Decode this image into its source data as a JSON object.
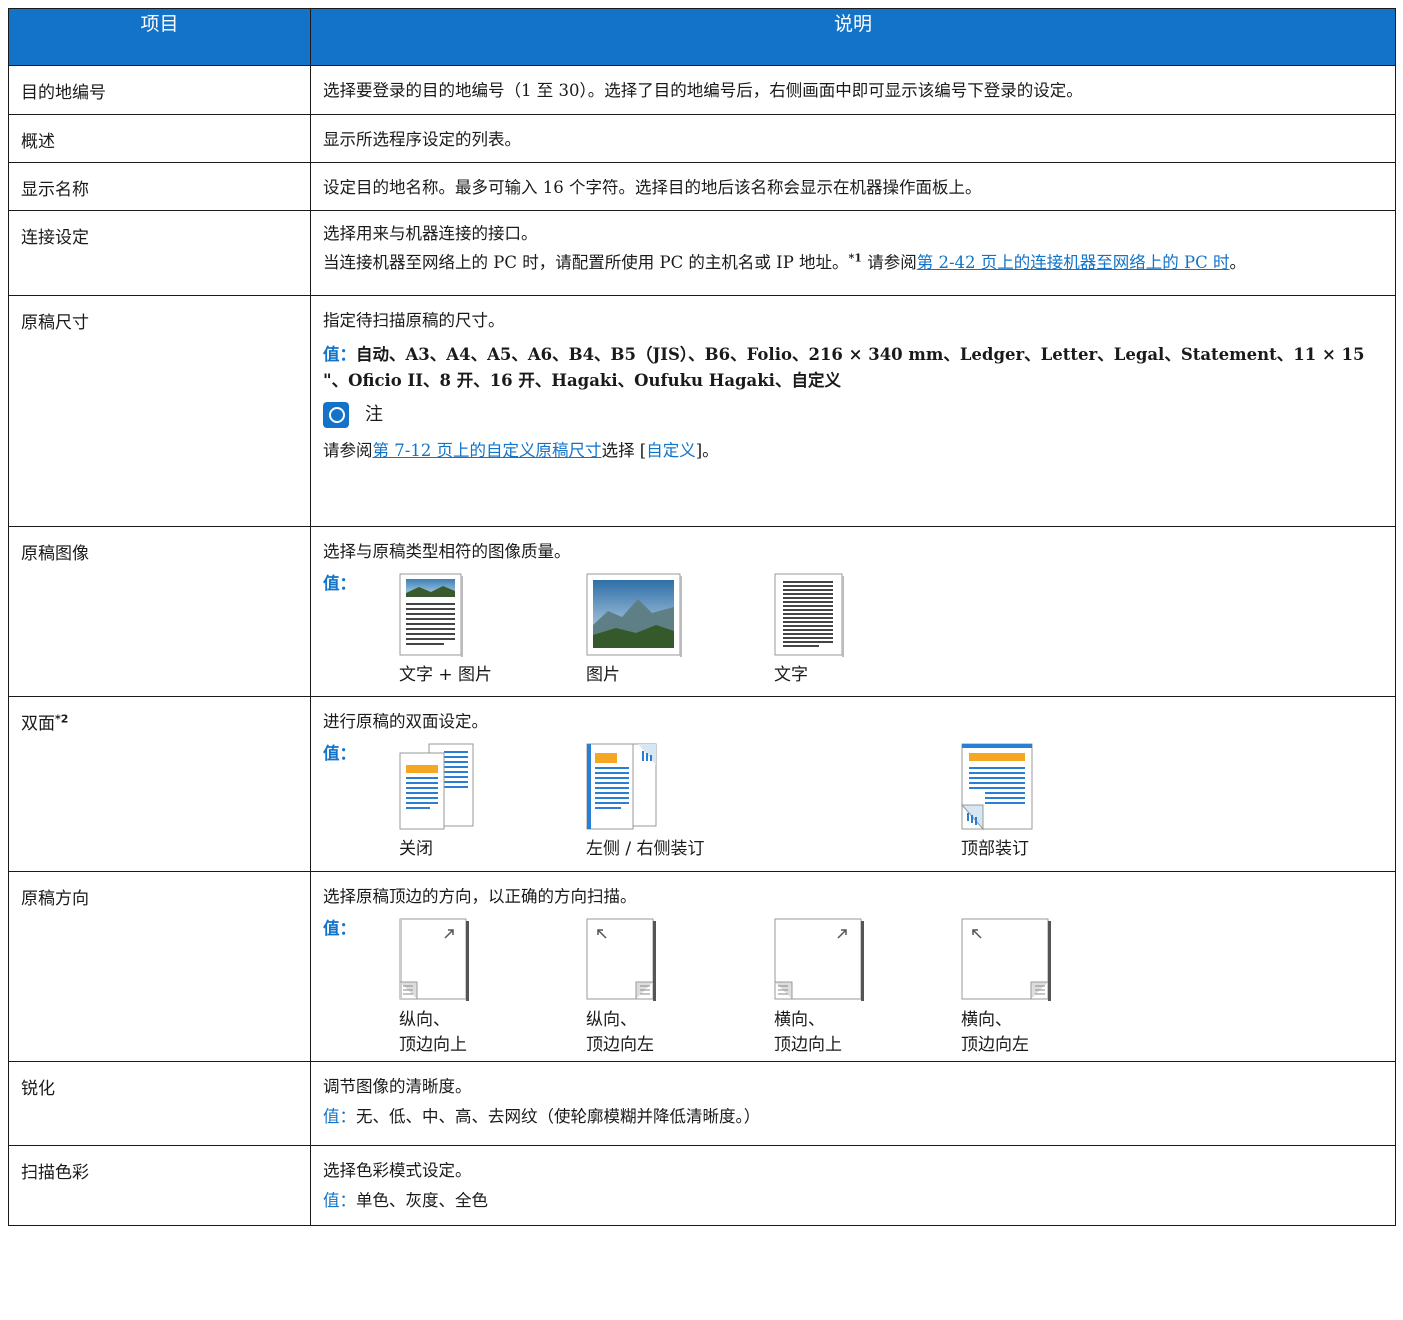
{
  "header": {
    "col_item": "项目",
    "col_desc": "说明"
  },
  "value_label": "值：",
  "rows": {
    "dest_no": {
      "item": "目的地编号",
      "desc": "选择要登录的目的地编号（1 至 30）。选择了目的地编号后，右侧画面中即可显示该编号下登录的设定。"
    },
    "overview": {
      "item": "概述",
      "desc": "显示所选程序设定的列表。"
    },
    "display_name": {
      "item": "显示名称",
      "desc": "设定目的地名称。最多可输入 16 个字符。选择目的地后该名称会显示在机器操作面板上。"
    },
    "connection": {
      "item": "连接设定",
      "desc1": "选择用来与机器连接的接口。",
      "desc2_a": "当连接机器至网络上的 PC 时，请配置所使用 PC 的主机名或 IP 地址。",
      "desc2_sup": "*1",
      "desc2_b": " 请参阅",
      "desc2_link": "第 2-42 页上的连接机器至网络上的 PC 时",
      "desc2_c": "。"
    },
    "orig_size": {
      "item": "原稿尺寸",
      "desc": "指定待扫描原稿的尺寸。",
      "values": "自动、A3、A4、A5、A6、B4、B5（JIS）、B6、Folio、216 × 340 mm、Ledger、Letter、Legal、Statement、11 × 15 \"、Oficio II、8 开、16 开、Hagaki、Oufuku Hagaki、自定义",
      "note_title": "注",
      "note_a": "请参阅",
      "note_link": "第 7-12 页上的自定义原稿尺寸",
      "note_b": "选择 [",
      "note_key": "自定义",
      "note_c": "]。"
    },
    "orig_image": {
      "item": "原稿图像",
      "desc": "选择与原稿类型相符的图像质量。",
      "options": [
        "文字 + 图片",
        "图片",
        "文字"
      ]
    },
    "duplex": {
      "item": "双面",
      "item_sup": "*2",
      "desc": "进行原稿的双面设定。",
      "options": [
        "关闭",
        "左侧 / 右侧装订",
        "顶部装订"
      ]
    },
    "orientation": {
      "item": "原稿方向",
      "desc": "选择原稿顶边的方向，以正确的方向扫描。",
      "options": [
        {
          "l1": "纵向、",
          "l2": "顶边向上"
        },
        {
          "l1": "纵向、",
          "l2": "顶边向左"
        },
        {
          "l1": "横向、",
          "l2": "顶边向上"
        },
        {
          "l1": "横向、",
          "l2": "顶边向左"
        }
      ]
    },
    "sharpness": {
      "item": "锐化",
      "desc": "调节图像的清晰度。",
      "values": "无、低、中、高、去网纹（使轮廓模糊并降低清晰度。）"
    },
    "color": {
      "item": "扫描色彩",
      "desc": "选择色彩模式设定。",
      "values": "单色、灰度、全色"
    }
  },
  "colors": {
    "accent": "#1273c9",
    "header_text": "#ffffff",
    "orange": "#f5a623"
  }
}
